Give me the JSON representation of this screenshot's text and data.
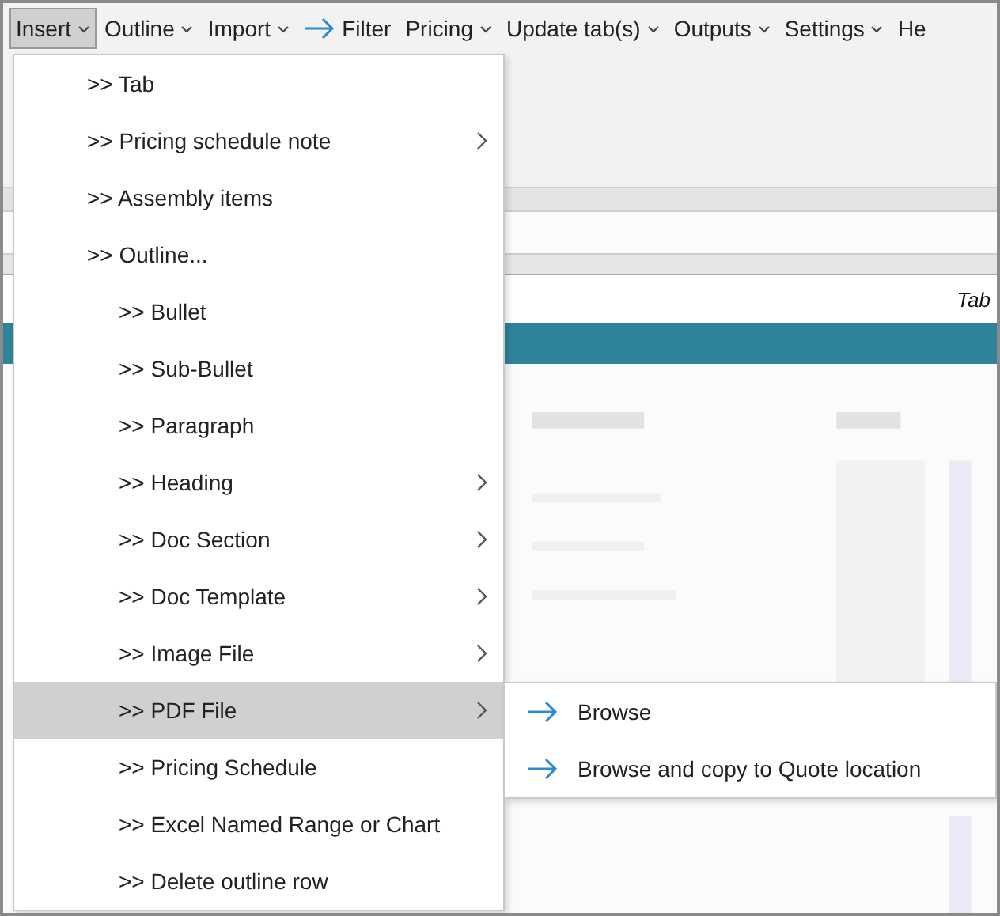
{
  "menubar": [
    {
      "label": "Insert",
      "kind": "dropdown",
      "selected": true
    },
    {
      "label": "Outline",
      "kind": "dropdown",
      "selected": false
    },
    {
      "label": "Import",
      "kind": "dropdown",
      "selected": false
    },
    {
      "label": "Filter",
      "kind": "action",
      "selected": false
    },
    {
      "label": "Pricing",
      "kind": "dropdown",
      "selected": false
    },
    {
      "label": "Update tab(s)",
      "kind": "dropdown",
      "selected": false
    },
    {
      "label": "Outputs",
      "kind": "dropdown",
      "selected": false
    },
    {
      "label": "Settings",
      "kind": "dropdown",
      "selected": false
    },
    {
      "label": "He",
      "kind": "cut",
      "selected": false
    }
  ],
  "sheet": {
    "header_label": "Tab"
  },
  "insert_menu": [
    {
      "label": ">> Tab",
      "submenu": false,
      "selected": false
    },
    {
      "label": ">> Pricing schedule note",
      "submenu": true,
      "selected": false
    },
    {
      "label": ">> Assembly items",
      "submenu": false,
      "selected": false
    },
    {
      "label": ">> Outline...",
      "submenu": false,
      "selected": false,
      "children": [
        {
          "label": ">> Bullet",
          "submenu": false,
          "selected": false
        },
        {
          "label": ">> Sub-Bullet",
          "submenu": false,
          "selected": false
        },
        {
          "label": ">> Paragraph",
          "submenu": false,
          "selected": false
        },
        {
          "label": ">> Heading",
          "submenu": true,
          "selected": false
        },
        {
          "label": ">> Doc Section",
          "submenu": true,
          "selected": false
        },
        {
          "label": ">> Doc Template",
          "submenu": true,
          "selected": false
        },
        {
          "label": ">> Image File",
          "submenu": true,
          "selected": false
        },
        {
          "label": ">> PDF File",
          "submenu": true,
          "selected": true
        },
        {
          "label": ">> Pricing Schedule",
          "submenu": false,
          "selected": false
        },
        {
          "label": ">> Excel Named Range or Chart",
          "submenu": false,
          "selected": false
        },
        {
          "label": ">> Delete outline row",
          "submenu": false,
          "selected": false
        }
      ]
    }
  ],
  "pdf_submenu": [
    {
      "label": "Browse"
    },
    {
      "label": "Browse and copy to Quote location"
    }
  ]
}
